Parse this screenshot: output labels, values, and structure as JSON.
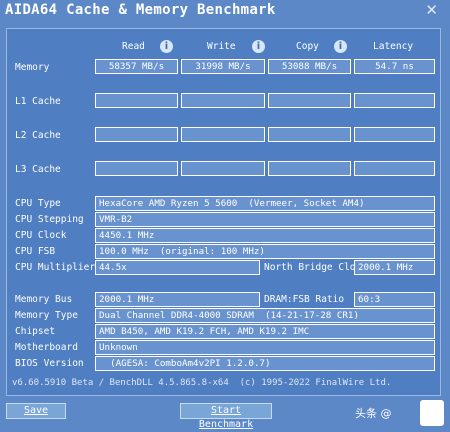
{
  "window": {
    "title": "AIDA64 Cache & Memory Benchmark",
    "close_glyph": "✕"
  },
  "columns": {
    "read": "Read",
    "write": "Write",
    "copy": "Copy",
    "latency": "Latency",
    "info_glyph": "i"
  },
  "rows": {
    "memory": {
      "label": "Memory",
      "read": "58357 MB/s",
      "write": "31998 MB/s",
      "copy": "53088 MB/s",
      "latency": "54.7 ns"
    },
    "l1": {
      "label": "L1 Cache",
      "read": "",
      "write": "",
      "copy": "",
      "latency": ""
    },
    "l2": {
      "label": "L2 Cache",
      "read": "",
      "write": "",
      "copy": "",
      "latency": ""
    },
    "l3": {
      "label": "L3 Cache",
      "read": "",
      "write": "",
      "copy": "",
      "latency": ""
    }
  },
  "cpu": {
    "type_label": "CPU Type",
    "type_value": "HexaCore AMD Ryzen 5 5600  (Vermeer, Socket AM4)",
    "stepping_label": "CPU Stepping",
    "stepping_value": "VMR-B2",
    "clock_label": "CPU Clock",
    "clock_value": "4450.1 MHz",
    "fsb_label": "CPU FSB",
    "fsb_value": "100.0 MHz  (original: 100 MHz)",
    "multiplier_label": "CPU Multiplier",
    "multiplier_value": "44.5x",
    "nb_clock_label": "North Bridge Clock",
    "nb_clock_value": "2000.1 MHz"
  },
  "memory_info": {
    "bus_label": "Memory Bus",
    "bus_value": "2000.1 MHz",
    "ratio_label": "DRAM:FSB Ratio",
    "ratio_value": "60:3",
    "type_label": "Memory Type",
    "type_value": "Dual Channel DDR4-4000 SDRAM  (14-21-17-28 CR1)",
    "chipset_label": "Chipset",
    "chipset_value": "AMD B450, AMD K19.2 FCH, AMD K19.2 IMC",
    "motherboard_label": "Motherboard",
    "motherboard_value": "Unknown",
    "bios_label": "BIOS Version",
    "bios_value": "  (AGESA: ComboAm4v2PI 1.2.0.7)"
  },
  "footer": {
    "version_text": "v6.60.5910 Beta / BenchDLL 4.5.865.8-x64  (c) 1995-2022 FinalWire Ltd."
  },
  "buttons": {
    "save": "Save",
    "start": "Start Benchmark"
  },
  "watermark": {
    "text": "头条 @"
  },
  "colors": {
    "background": "#5c88c8",
    "field": "#6993cf",
    "text": "#ffffff"
  }
}
